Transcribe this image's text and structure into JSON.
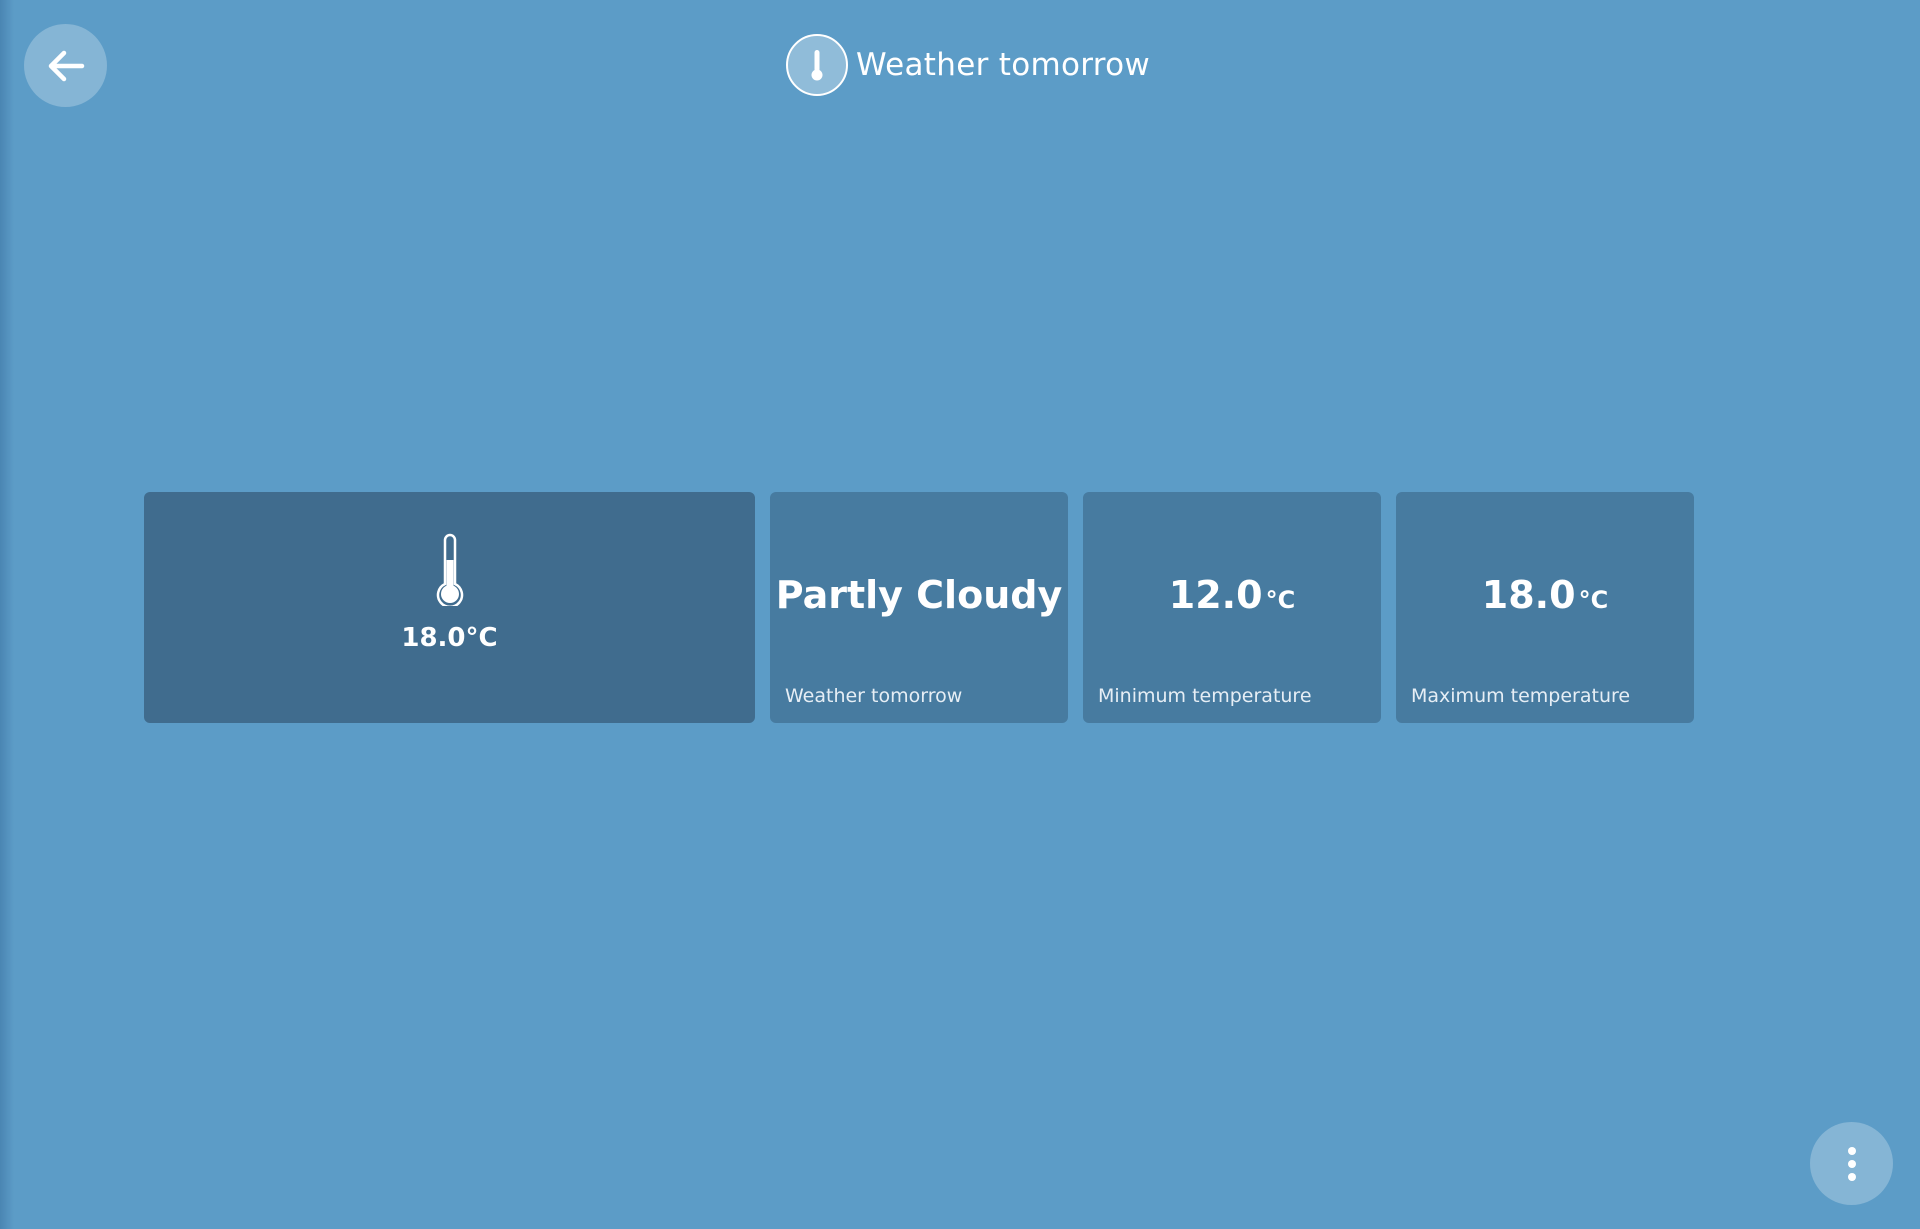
{
  "header": {
    "title": "Weather tomorrow",
    "icon": "thermometer-icon"
  },
  "navigation": {
    "back_icon": "arrow-left-icon",
    "menu_icon": "more-vertical-icon"
  },
  "main_tile": {
    "icon": "thermometer-icon",
    "temperature": "18.0°C"
  },
  "tiles": [
    {
      "value": "Partly Cloudy",
      "unit": "",
      "label": "Weather tomorrow"
    },
    {
      "value": "12.0",
      "unit": "°C",
      "label": "Minimum temperature"
    },
    {
      "value": "18.0",
      "unit": "°C",
      "label": "Maximum temperature"
    }
  ],
  "colors": {
    "background": "#5c9cc7",
    "main_tile": "#406c8e",
    "tile": "#477ba0",
    "text": "#ffffff"
  }
}
